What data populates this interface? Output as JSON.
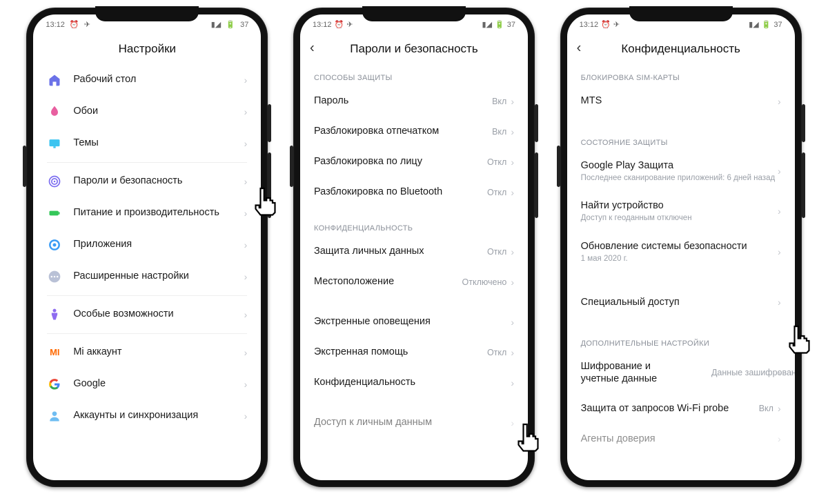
{
  "status": {
    "time": "13:12",
    "battery": "37"
  },
  "screen1": {
    "title": "Настройки",
    "items": [
      {
        "label": "Рабочий стол"
      },
      {
        "label": "Обои"
      },
      {
        "label": "Темы"
      },
      {
        "label": "Пароли и безопасность"
      },
      {
        "label": "Питание и производительность"
      },
      {
        "label": "Приложения"
      },
      {
        "label": "Расширенные настройки"
      },
      {
        "label": "Особые возможности"
      },
      {
        "label": "Mi аккаунт"
      },
      {
        "label": "Google"
      },
      {
        "label": "Аккаунты и синхронизация"
      }
    ]
  },
  "screen2": {
    "title": "Пароли и безопасность",
    "sec_protection": "СПОСОБЫ ЗАЩИТЫ",
    "sec_privacy": "КОНФИДЕНЦИАЛЬНОСТЬ",
    "items": {
      "password": {
        "label": "Пароль",
        "value": "Вкл"
      },
      "fingerprint": {
        "label": "Разблокировка отпечатком",
        "value": "Вкл"
      },
      "face": {
        "label": "Разблокировка по лицу",
        "value": "Откл"
      },
      "bluetooth": {
        "label": "Разблокировка по Bluetooth",
        "value": "Откл"
      },
      "personal": {
        "label": "Защита личных данных",
        "value": "Откл"
      },
      "location": {
        "label": "Местоположение",
        "value": "Отключено"
      },
      "emergency_alerts": {
        "label": "Экстренные оповещения",
        "value": ""
      },
      "emergency_help": {
        "label": "Экстренная помощь",
        "value": "Откл"
      },
      "confidentiality": {
        "label": "Конфиденциальность",
        "value": ""
      },
      "personal_access": {
        "label": "Доступ к личным данным",
        "value": ""
      }
    }
  },
  "screen3": {
    "title": "Конфиденциальность",
    "sec_sim": "БЛОКИРОВКА SIM-КАРТЫ",
    "sec_status": "СОСТОЯНИЕ ЗАЩИТЫ",
    "sec_extra": "ДОПОЛНИТЕЛЬНЫЕ НАСТРОЙКИ",
    "items": {
      "mts": {
        "label": "MTS"
      },
      "play": {
        "label": "Google Play Защита",
        "sub": "Последнее сканирование приложений: 6 дней назад"
      },
      "find": {
        "label": "Найти устройство",
        "sub": "Доступ к геоданным отключен"
      },
      "update": {
        "label": "Обновление системы безопасности",
        "sub": "1 мая 2020 г."
      },
      "special": {
        "label": "Специальный доступ"
      },
      "encrypt": {
        "label": "Шифрование и учетные данные",
        "value": "Данные зашифрованы"
      },
      "wifi": {
        "label": "Защита от запросов Wi-Fi probe",
        "value": "Вкл"
      },
      "trust": {
        "label": "Агенты доверия"
      }
    }
  }
}
